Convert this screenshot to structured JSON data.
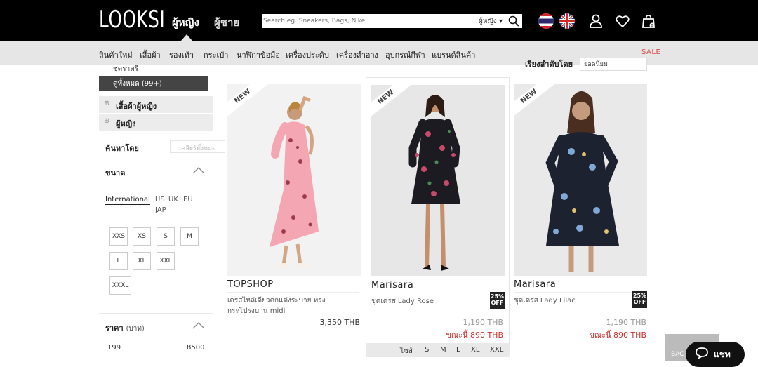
{
  "header": {
    "logo": "LOOKSI",
    "gender_women": "ผู้หญิง",
    "gender_men": "ผู้ชาย",
    "search_placeholder": "Search eg. Sneakers, Bags, Nike",
    "search_scope": "ผู้หญิง ▾"
  },
  "nav": {
    "items": [
      "สินค้าใหม่",
      "เสื้อผ้า",
      "รองเท้า",
      "กระเป๋า",
      "นาฬิกาข้อมือ",
      "เครื่องประดับ",
      "เครื่องสำอาง",
      "อุปกรณ์กีฬา",
      "แบรนด์สินค้า"
    ],
    "sale": "SALE"
  },
  "sidebar": {
    "sub_item": "ชุดราตรี",
    "active_item": "ดูทั้งหมด (99+)",
    "cat_women_clothing": "เสื้อผ้าผู้หญิง",
    "cat_women": "ผู้หญิง",
    "filter_label": "ค้นหาโดย",
    "clear_all": "เคลียร์ทั้งหมด",
    "size_title": "ขนาด",
    "size_tabs": [
      "International",
      "US",
      "UK",
      "EU",
      "JAP"
    ],
    "sizes": [
      "XXS",
      "XS",
      "S",
      "M",
      "L",
      "XL",
      "XXL",
      "XXXL"
    ],
    "price_title": "ราคา",
    "price_unit": "(บาท)",
    "price_min": "199",
    "price_max": "8500"
  },
  "sort": {
    "label": "เรียงลำดับโดย",
    "value": "ยอดนิยม"
  },
  "products": [
    {
      "ribbon": "NEW",
      "brand": "TOPSHOP",
      "name": "เดรสไหล่เดียวตกแต่งระบาย ทรงกระโปรงบาน midi",
      "price": "3,350 THB"
    },
    {
      "ribbon": "NEW",
      "brand": "Marisara",
      "name": "ชุดเดรส Lady Rose",
      "badge": "25% OFF",
      "old_price": "1,190 THB",
      "sale_price": "ขณะนี้ 890 THB",
      "sizes_label": "ไซส์",
      "sizes": [
        "S",
        "M",
        "L",
        "XL",
        "XXL"
      ]
    },
    {
      "ribbon": "NEW",
      "brand": "Marisara",
      "name": "ชุดเดรส Lady Lilac",
      "badge": "25% OFF",
      "old_price": "1,190 THB",
      "sale_price": "ขณะนี้ 890 THB"
    }
  ],
  "floating": {
    "back": "BAC",
    "chat": "แชท"
  },
  "colors": {
    "header_bg": "#000000",
    "nav_bg": "#e6e6e6",
    "sale_red": "#c9302c"
  }
}
